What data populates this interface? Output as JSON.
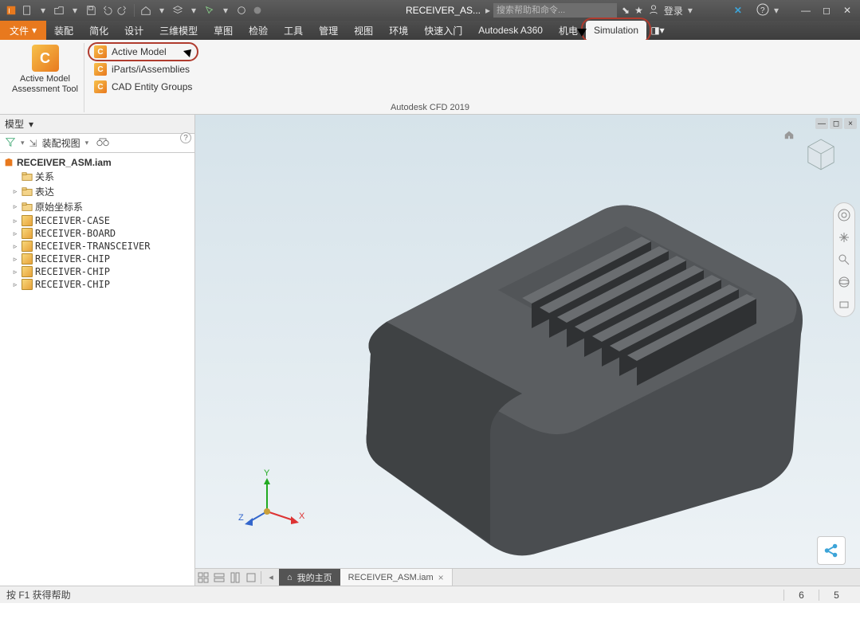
{
  "title_doc": "RECEIVER_AS...",
  "search_placeholder": "搜索帮助和命令...",
  "login_label": "登录",
  "menu": {
    "file": "文件",
    "assemble": "装配",
    "simplify": "简化",
    "design": "设计",
    "model3d": "三维模型",
    "sketch": "草图",
    "inspect": "检验",
    "tools": "工具",
    "manage": "管理",
    "view": "视图",
    "env": "环境",
    "quickstart": "快速入门",
    "a360": "Autodesk A360",
    "mech": "机电",
    "simulation": "Simulation"
  },
  "ribbon": {
    "big_label_l1": "Active Model",
    "big_label_l2": "Assessment Tool",
    "item1": "Active Model",
    "item2": "iParts/iAssemblies",
    "item3": "CAD Entity Groups",
    "panel_label": "Autodesk CFD 2019"
  },
  "browser": {
    "header": "模型",
    "filter": "装配视图",
    "root": "RECEIVER_ASM.iam",
    "nodes": [
      {
        "icon": "folder",
        "label": "关系",
        "tw": ""
      },
      {
        "icon": "folder-g",
        "label": "表达",
        "tw": "▹"
      },
      {
        "icon": "folder",
        "label": "原始坐标系",
        "tw": "▹"
      },
      {
        "icon": "cube",
        "label": "RECEIVER-CASE",
        "tw": "▹"
      },
      {
        "icon": "cube",
        "label": "RECEIVER-BOARD",
        "tw": "▹"
      },
      {
        "icon": "cube",
        "label": "RECEIVER-TRANSCEIVER",
        "tw": "▹"
      },
      {
        "icon": "cube",
        "label": "RECEIVER-CHIP",
        "tw": "▹"
      },
      {
        "icon": "cube",
        "label": "RECEIVER-CHIP",
        "tw": "▹"
      },
      {
        "icon": "cube",
        "label": "RECEIVER-CHIP",
        "tw": "▹"
      }
    ]
  },
  "doctabs": {
    "home": "我的主页",
    "doc": "RECEIVER_ASM.iam"
  },
  "status": {
    "help": "按 F1 获得帮助",
    "c1": "6",
    "c2": "5"
  },
  "triad": {
    "x": "X",
    "y": "Y",
    "z": "Z"
  }
}
